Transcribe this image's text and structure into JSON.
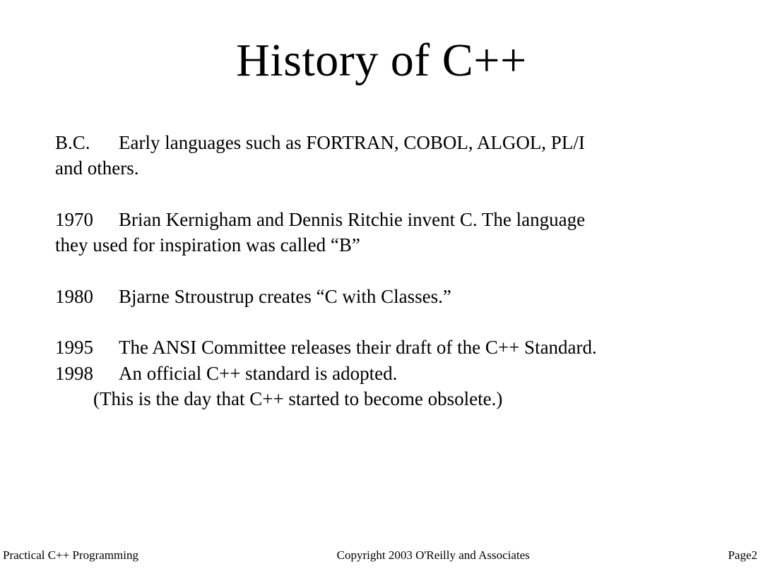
{
  "title": "History of C++",
  "entries": {
    "bc": {
      "label": "B.C.",
      "line1": "Early languages such as FORTRAN, COBOL, ALGOL, PL/I",
      "line2": "and others."
    },
    "y1970": {
      "label": "1970",
      "line1": "Brian Kernigham and Dennis Ritchie invent C. The language",
      "line2": "they used for inspiration was called “B”"
    },
    "y1980": {
      "label": "1980",
      "line1": "Bjarne Stroustrup  creates “C with Classes.”"
    },
    "y1995": {
      "label": "1995",
      "line1": "The ANSI Committee releases their draft of the C++ Standard."
    },
    "y1998": {
      "label": "1998",
      "line1": "An official C++ standard is adopted.",
      "note": "(This is the day that C++ started to become obsolete.)"
    }
  },
  "footer": {
    "left": "Practical C++ Programming",
    "center": "Copyright 2003 O'Reilly and Associates",
    "right": "Page2"
  }
}
